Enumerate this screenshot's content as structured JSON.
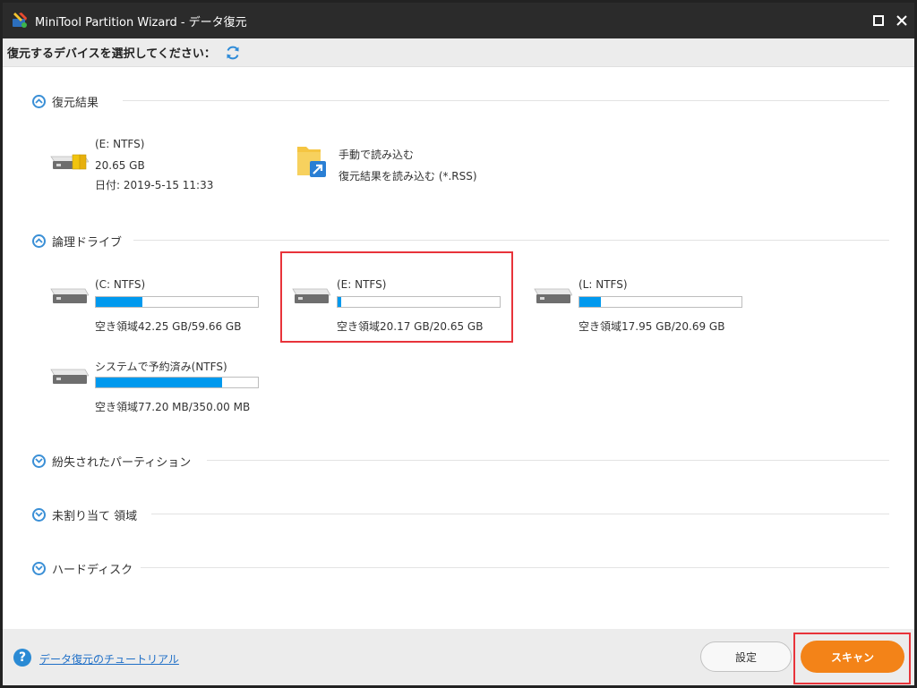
{
  "window": {
    "title": "MiniTool Partition Wizard - データ復元"
  },
  "subheader": {
    "text": "復元するデバイスを選択してください："
  },
  "sections": {
    "recovery_result": "復元結果",
    "logical_drives": "論理ドライブ",
    "lost_partitions": "紛失されたパーティション",
    "unallocated": "未割り当て 領域",
    "hard_disk": "ハードディスク"
  },
  "recovery_result": {
    "item": {
      "name": "(E: NTFS)",
      "size": "20.65 GB",
      "date": "日付: 2019-5-15 11:33"
    },
    "manual_load": {
      "title": "手動で読み込む",
      "subtitle": "復元結果を読み込む (*.RSS)"
    }
  },
  "drives": [
    {
      "name": "(C: NTFS)",
      "free": "空き領域42.25 GB/59.66 GB",
      "used_fraction": 0.29
    },
    {
      "name": "(E: NTFS)",
      "free": "空き領域20.17 GB/20.65 GB",
      "used_fraction": 0.02,
      "selected": true
    },
    {
      "name": "(L: NTFS)",
      "free": "空き領域17.95 GB/20.69 GB",
      "used_fraction": 0.13
    },
    {
      "name": "システムで予約済み(NTFS)",
      "free": "空き領域77.20 MB/350.00 MB",
      "used_fraction": 0.78
    }
  ],
  "footer": {
    "help_link": "データ復元のチュートリアル",
    "settings_label": "設定",
    "scan_label": "スキャン"
  },
  "colors": {
    "accent": "#0099ee",
    "scan_button": "#f38318",
    "highlight_box": "#e8333a",
    "title_bar": "#2b2b2b"
  },
  "icons": {
    "app": "app-logo-icon",
    "refresh": "refresh-icon",
    "collapse": "chevron-up-circle-icon",
    "expand": "chevron-down-circle-icon",
    "drive": "hard-drive-icon",
    "folder": "folder-arrow-icon",
    "help": "help-icon"
  }
}
